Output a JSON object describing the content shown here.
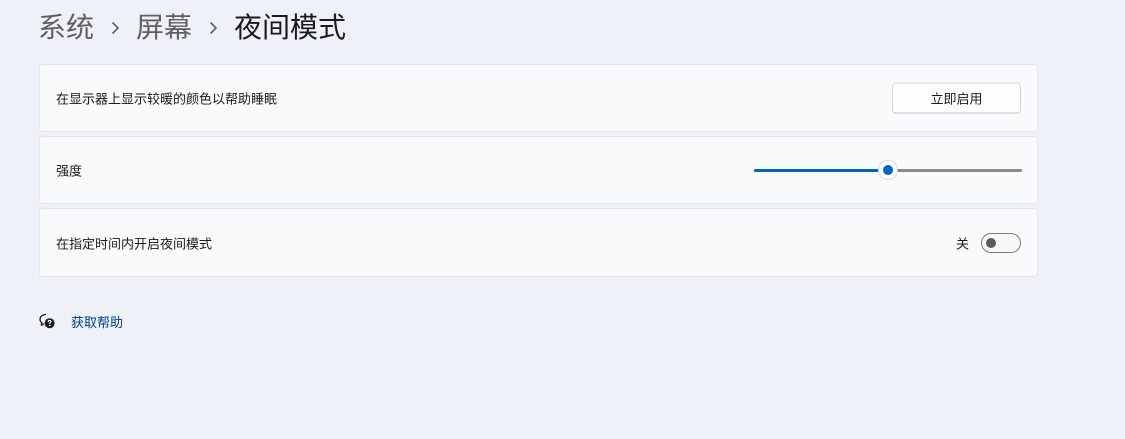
{
  "breadcrumb": {
    "items": [
      "系统",
      "屏幕"
    ],
    "current": "夜间模式"
  },
  "settings": {
    "night_light": {
      "label": "在显示器上显示较暖的颜色以帮助睡眠",
      "button_label": "立即启用"
    },
    "strength": {
      "label": "强度",
      "value_percent": 50
    },
    "schedule": {
      "label": "在指定时间内开启夜间模式",
      "toggle_state": "关",
      "toggle_on": false
    }
  },
  "help": {
    "link_text": "获取帮助"
  },
  "icons": {
    "breadcrumb_separator": "chevron-right-icon",
    "help": "help-chat-icon"
  },
  "colors": {
    "accent": "#0067c0",
    "link": "#003e92",
    "background": "#eef2f8",
    "card": "#f9fafc"
  }
}
